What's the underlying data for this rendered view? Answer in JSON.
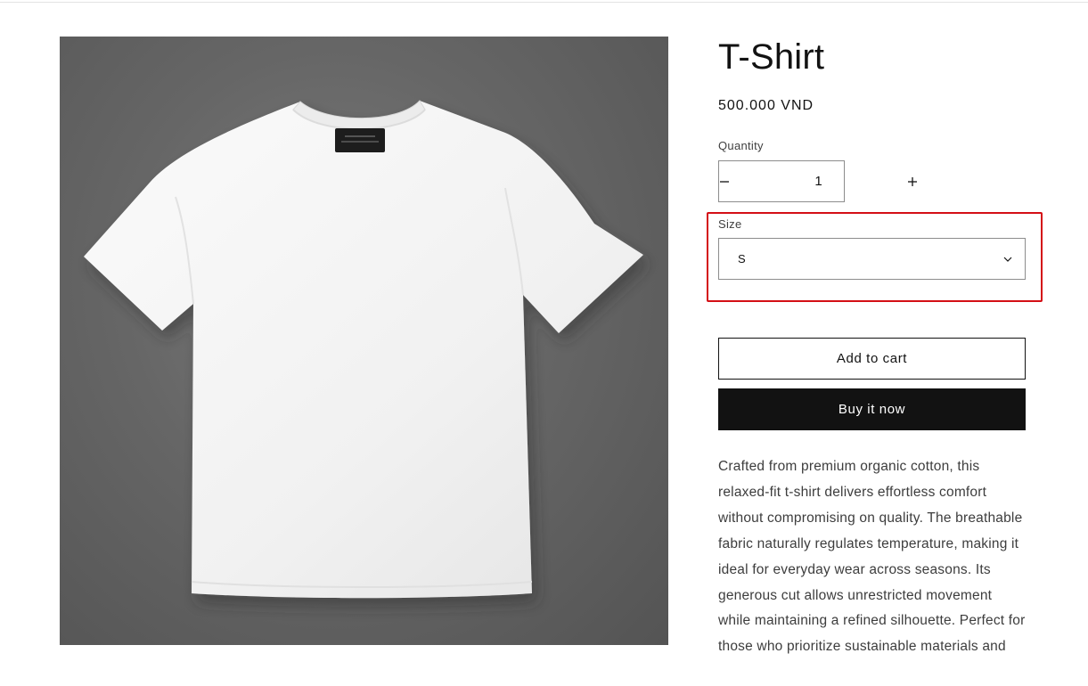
{
  "product": {
    "title": "T-Shirt",
    "price": "500.000 VND",
    "image_label_line1": "TOKYOCITY",
    "image_label_line2": "MINIMALIST COTTON STUDIO"
  },
  "quantity": {
    "label": "Quantity",
    "value": "1",
    "decrease_icon": "minus-icon",
    "increase_icon": "plus-icon"
  },
  "size": {
    "label": "Size",
    "selected": "S",
    "chevron_icon": "chevron-down-icon"
  },
  "buttons": {
    "add_to_cart": "Add to cart",
    "buy_now": "Buy it now"
  },
  "description": "Crafted from premium organic cotton, this relaxed-fit t-shirt delivers effortless comfort without compromising on quality. The breathable fabric naturally regulates temperature, making it ideal for everyday wear across seasons. Its generous cut allows unrestricted movement while maintaining a refined silhouette. Perfect for those who prioritize sustainable materials and",
  "colors": {
    "text": "#121212",
    "highlight": "#d40f16",
    "buy_button_bg": "#121212",
    "media_bg": "#666666"
  }
}
